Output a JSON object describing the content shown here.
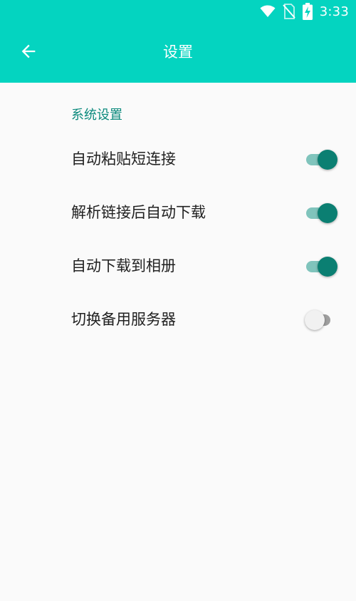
{
  "status_bar": {
    "time": "3:33",
    "icons": [
      "wifi-icon",
      "no-sim-icon",
      "battery-charging-icon"
    ]
  },
  "toolbar": {
    "title": "设置",
    "back_icon": "arrow-back-icon"
  },
  "colors": {
    "primary": "#04d4c0",
    "accent": "#0b7f72",
    "section_header": "#0c8a7d",
    "background": "#fafafa"
  },
  "settings": {
    "section_title": "系统设置",
    "items": [
      {
        "label": "自动粘贴短连接",
        "enabled": true
      },
      {
        "label": "解析链接后自动下载",
        "enabled": true
      },
      {
        "label": "自动下载到相册",
        "enabled": true
      },
      {
        "label": "切换备用服务器",
        "enabled": false
      }
    ]
  }
}
